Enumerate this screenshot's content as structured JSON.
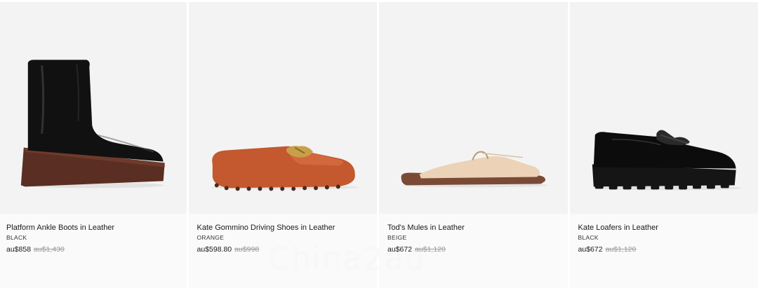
{
  "products": [
    {
      "name": "Platform Ankle Boots in Leather",
      "color": "BLACK",
      "price": "au$858",
      "original_price": "au$1,430"
    },
    {
      "name": "Kate Gommino Driving Shoes in Leather",
      "color": "ORANGE",
      "price": "au$598.80",
      "original_price": "au$998"
    },
    {
      "name": "Tod's Mules in Leather",
      "color": "BEIGE",
      "price": "au$672",
      "original_price": "au$1,120"
    },
    {
      "name": "Kate Loafers in Leather",
      "color": "BLACK",
      "price": "au$672",
      "original_price": "au$1,120"
    }
  ],
  "watermark": "Chinа2au",
  "colors": {
    "tile_background": "#f3f3f3",
    "info_background": "#fafafa",
    "strike_price": "#9a9a9a"
  }
}
